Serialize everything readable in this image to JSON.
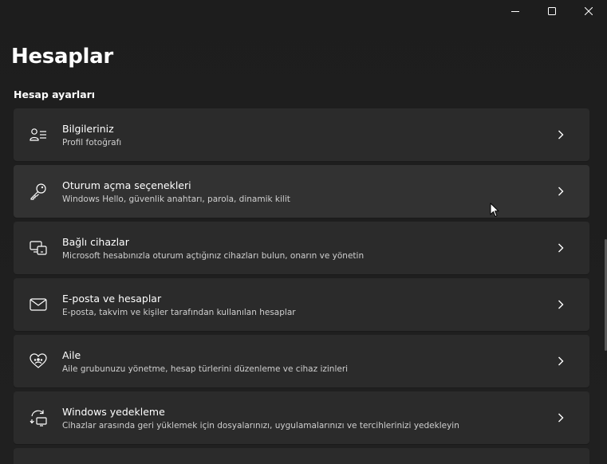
{
  "window": {
    "controls": {
      "minimize_icon": "minimize-icon",
      "maximize_icon": "maximize-icon",
      "close_icon": "close-icon"
    }
  },
  "page": {
    "title": "Hesaplar",
    "section_title": "Hesap ayarları"
  },
  "items": [
    {
      "title": "Bilgileriniz",
      "subtitle": "Profil fotoğrafı",
      "icon": "person-card-icon"
    },
    {
      "title": "Oturum açma seçenekleri",
      "subtitle": "Windows Hello, güvenlik anahtarı, parola, dinamik kilit",
      "icon": "key-icon"
    },
    {
      "title": "Bağlı cihazlar",
      "subtitle": "Microsoft hesabınızla oturum açtığınız cihazları bulun, onarın ve yönetin",
      "icon": "devices-icon"
    },
    {
      "title": "E-posta ve hesaplar",
      "subtitle": "E-posta, takvim ve kişiler tarafından kullanılan hesaplar",
      "icon": "mail-icon"
    },
    {
      "title": "Aile",
      "subtitle": "Aile grubunuzu yönetme, hesap türlerini düzenleme ve cihaz izinleri",
      "icon": "heart-family-icon"
    },
    {
      "title": "Windows yedekleme",
      "subtitle": "Cihazlar arasında geri yüklemek için dosyalarınızı, uygulamalarınızı ve tercihlerinizi yedekleyin",
      "icon": "backup-sync-icon"
    }
  ],
  "colors": {
    "background": "#202020",
    "card": "#2b2b2b",
    "card_hover": "#323232",
    "text": "#ffffff",
    "subtext": "#cfcfcf"
  }
}
